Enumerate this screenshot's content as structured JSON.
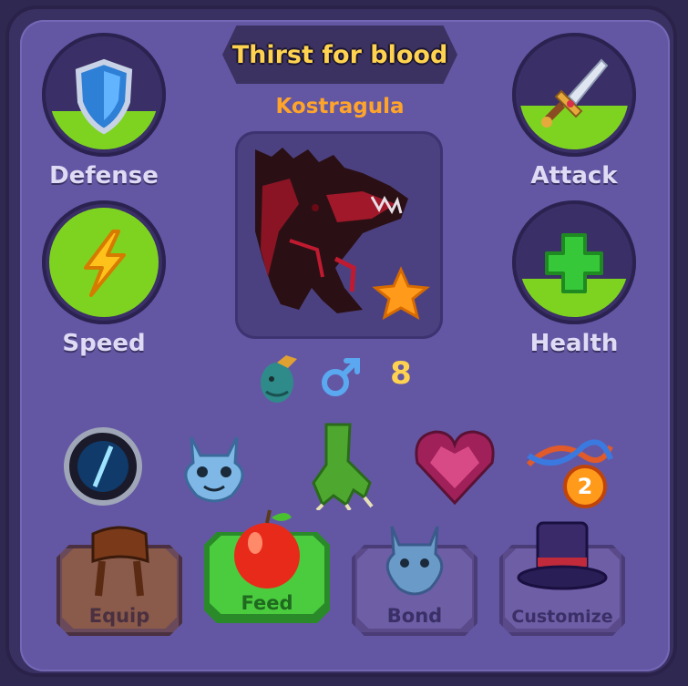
{
  "title": "Thirst for blood",
  "creature": {
    "name": "Kostragula",
    "level": "8"
  },
  "stats": [
    {
      "key": "defense",
      "label": "Defense",
      "fill": 0.35
    },
    {
      "key": "attack",
      "label": "Attack",
      "fill": 0.4
    },
    {
      "key": "speed",
      "label": "Speed",
      "fill": 1.0
    },
    {
      "key": "health",
      "label": "Health",
      "fill": 0.35
    }
  ],
  "items": [
    "ability-orb-icon",
    "dragon-face-icon",
    "claw-icon",
    "heart-gem-icon",
    "dna-icon"
  ],
  "item_badge": "2",
  "buttons": {
    "equip": "Equip",
    "feed": "Feed",
    "bond": "Bond",
    "customize": "Customize"
  },
  "colors": {
    "panel": "#6357a4",
    "title_text": "#ffd34f",
    "name_text": "#ffa42a",
    "stat_fill": "#7ed321",
    "feed_button": "#3fbf3a",
    "equip_button": "#8a5a3a"
  }
}
